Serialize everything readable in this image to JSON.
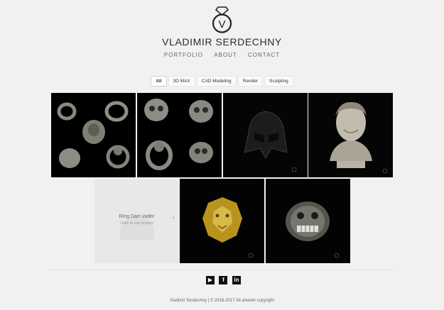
{
  "header": {
    "logo_letter": "V",
    "site_title": "VLADIMIR SERDECHNY"
  },
  "nav": [
    "PORTFOLIO",
    "ABOUT",
    "CONTACT"
  ],
  "filters": {
    "items": [
      "All",
      "3D MAX",
      "CAD Modeling",
      "Render",
      "Sculpting"
    ],
    "active": "All"
  },
  "gallery": {
    "hover_item": {
      "title": "Ring Dart Vader",
      "subtitle": "Click to see project",
      "arrow": "›"
    },
    "colors": {
      "tile_bg": "#000000",
      "gold": "#c9a227",
      "silver": "#9a9a90",
      "accent_green": "#2eb82e"
    }
  },
  "social": {
    "icons": [
      {
        "name": "youtube-icon",
        "glyph": "▶"
      },
      {
        "name": "facebook-icon",
        "glyph": "f"
      },
      {
        "name": "linkedin-icon",
        "glyph": "in"
      }
    ]
  },
  "footer": {
    "text": "Vladimir Serdechny | © 2016-2017 All artwork copyright"
  }
}
